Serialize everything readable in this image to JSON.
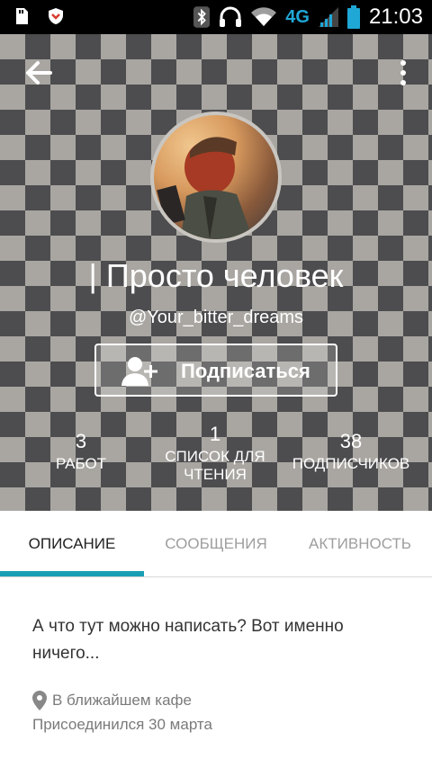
{
  "status_bar": {
    "time": "21:03",
    "network": "4G",
    "icons": [
      "sd-card-icon",
      "shield-icon",
      "bluetooth-icon",
      "headset-icon",
      "wifi-icon",
      "signal-icon",
      "battery-icon"
    ]
  },
  "header": {
    "back_icon": "arrow-left-icon",
    "more_icon": "more-vert-icon",
    "display_name": "| Просто человек",
    "username": "@Your_bitter_dreams",
    "follow_button_label": "Подписаться"
  },
  "stats": [
    {
      "value": "3",
      "label": "РАБОТ"
    },
    {
      "value": "1",
      "label": "СПИСОК ДЛЯ ЧТЕНИЯ"
    },
    {
      "value": "38",
      "label": "ПОДПИСЧИКОВ"
    }
  ],
  "tabs": [
    {
      "label": "ОПИСАНИЕ",
      "active": true
    },
    {
      "label": "СООБЩЕНИЯ",
      "active": false
    },
    {
      "label": "АКТИВНОСТЬ",
      "active": false
    }
  ],
  "about": {
    "bio": "А что тут можно написать? Вот именно ничего...",
    "location": "В ближайшем кафе",
    "joined": "Присоединился 30 марта"
  },
  "colors": {
    "accent": "#1b9fb5",
    "status_bar_bg": "#000000",
    "network_blue": "#1fa7d6"
  }
}
